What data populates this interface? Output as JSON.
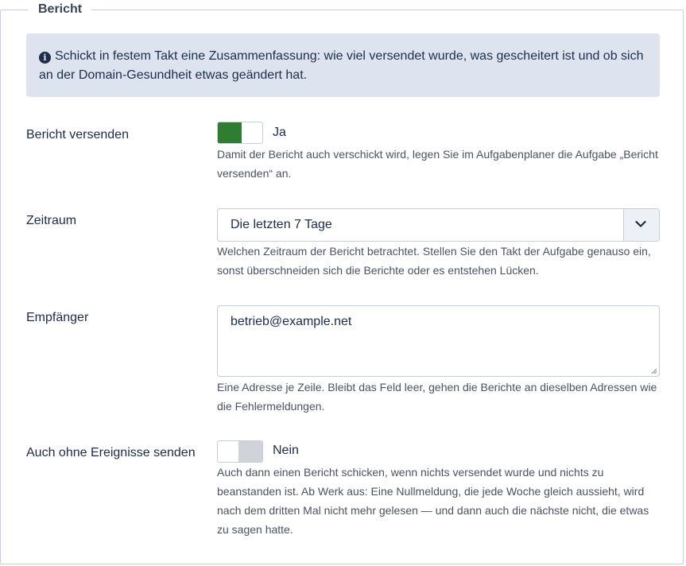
{
  "fieldset": {
    "legend": "Bericht"
  },
  "info": {
    "icon": "info-circle-icon",
    "text": "Schickt in festem Takt eine Zusammenfassung: wie viel versendet wurde, was gescheitert ist und ob sich an der Domain-Gesundheit etwas geändert hat."
  },
  "send_report": {
    "label": "Bericht versenden",
    "toggle_state": "on",
    "toggle_text": "Ja",
    "help": "Damit der Bericht auch verschickt wird, legen Sie im Aufgabenplaner die Aufgabe „Bericht versenden“ an."
  },
  "period": {
    "label": "Zeitraum",
    "selected": "Die letzten 7 Tage",
    "help": "Welchen Zeitraum der Bericht betrachtet. Stellen Sie den Takt der Aufgabe genauso ein, sonst überschneiden sich die Berichte oder es entstehen Lücken."
  },
  "recipients": {
    "label": "Empfänger",
    "value": "betrieb@example.net",
    "help": "Eine Adresse je Zeile. Bleibt das Feld leer, gehen die Berichte an dieselben Adressen wie die Fehlermeldungen."
  },
  "send_empty": {
    "label": "Auch ohne Ereignisse senden",
    "toggle_state": "off",
    "toggle_text": "Nein",
    "help": "Auch dann einen Bericht schicken, wenn nichts versendet wurde und nichts zu beanstanden ist. Ab Werk aus: Eine Nullmeldung, die jede Woche gleich aussieht, wird nach dem dritten Mal nicht mehr gelesen — und dann auch die nächste nicht, die etwas zu sagen hatte."
  },
  "colors": {
    "accent_on": "#2e7d32",
    "info_bg": "#dde4f0"
  }
}
